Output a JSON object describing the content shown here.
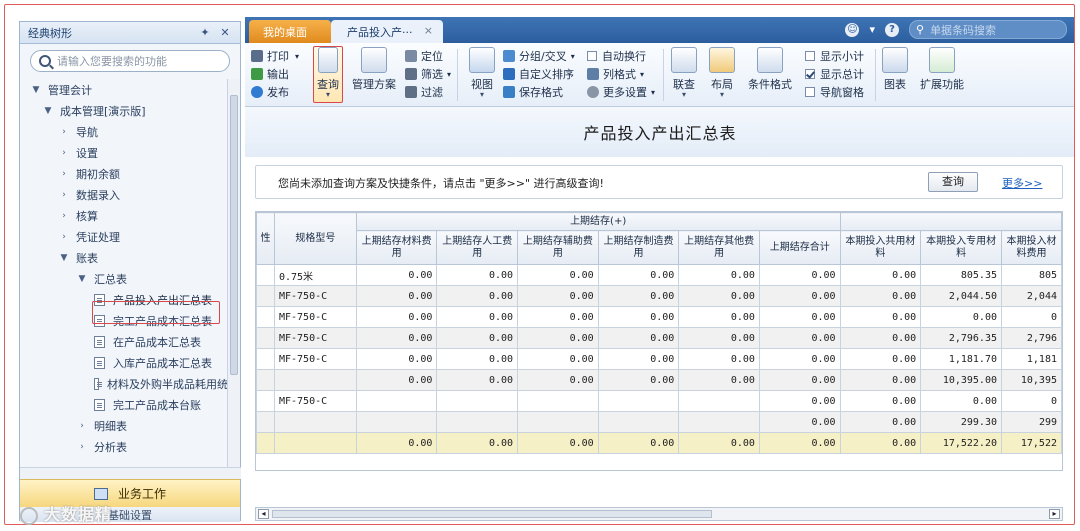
{
  "sidebar": {
    "title": "经典树形",
    "search_placeholder": "请输入您要搜索的功能",
    "tree": [
      {
        "label": "管理会计",
        "level": 0,
        "arrow": "▼"
      },
      {
        "label": "成本管理[演示版]",
        "level": 1,
        "arrow": "▼"
      },
      {
        "label": "导航",
        "level": 2,
        "arrow": "›"
      },
      {
        "label": "设置",
        "level": 2,
        "arrow": "›"
      },
      {
        "label": "期初余额",
        "level": 2,
        "arrow": "›"
      },
      {
        "label": "数据录入",
        "level": 2,
        "arrow": "›"
      },
      {
        "label": "核算",
        "level": 2,
        "arrow": "›"
      },
      {
        "label": "凭证处理",
        "level": 2,
        "arrow": "›"
      },
      {
        "label": "账表",
        "level": 2,
        "arrow": "▼"
      },
      {
        "label": "汇总表",
        "level": 3,
        "arrow": "▼"
      },
      {
        "label": "产品投入产出汇总表",
        "level": 4,
        "doc": true,
        "selected": true
      },
      {
        "label": "完工产品成本汇总表",
        "level": 4,
        "doc": true
      },
      {
        "label": "在产品成本汇总表",
        "level": 4,
        "doc": true
      },
      {
        "label": "入库产品成本汇总表",
        "level": 4,
        "doc": true
      },
      {
        "label": "材料及外购半成品耗用统",
        "level": 4,
        "doc": true
      },
      {
        "label": "完工产品成本台账",
        "level": 4,
        "doc": true
      },
      {
        "label": "明细表",
        "level": 3,
        "arrow": "›"
      },
      {
        "label": "分析表",
        "level": 3,
        "arrow": "›"
      }
    ],
    "work_label": "业务工作",
    "base_label": "基础设置"
  },
  "tabs": {
    "home": "我的桌面",
    "current": "产品投入产···",
    "search_placeholder": "单据条码搜索"
  },
  "toolbar": {
    "print": "打印",
    "export": "输出",
    "publish": "发布",
    "query": "查询",
    "plan": "管理方案",
    "locate": "定位",
    "filter": "筛选",
    "filter2": "过滤",
    "view": "视图",
    "group": "分组/交叉",
    "custom_sort": "自定义排序",
    "save_format": "保存格式",
    "auto_wrap": "自动换行",
    "col_format": "列格式",
    "more_settings": "更多设置",
    "link": "联查",
    "layout": "布局",
    "cond_format": "条件格式",
    "show_subtotal": "显示小计",
    "show_total": "显示总计",
    "nav_pane": "导航窗格",
    "chart": "图表",
    "extend": "扩展功能",
    "show_total_checked": true
  },
  "report": {
    "title": "产品投入产出汇总表",
    "hint": "您尚未添加查询方案及快捷条件，请点击 \"更多>>\" 进行高级查询!",
    "query_button": "查询",
    "more_link": "更多>>"
  },
  "table": {
    "group_header": "上期结存(+)",
    "col_first": "性",
    "col_spec": "规格型号",
    "columns": [
      "上期结存材料费用",
      "上期结存人工费用",
      "上期结存辅助费用",
      "上期结存制造费用",
      "上期结存其他费用",
      "上期结存合计",
      "本期投入共用材料",
      "本期投入专用材料",
      "本期投入材料费用"
    ],
    "rows": [
      {
        "spec": "0.75米",
        "vals": [
          "0.00",
          "0.00",
          "0.00",
          "0.00",
          "0.00",
          "0.00",
          "0.00",
          "805.35",
          "805"
        ]
      },
      {
        "spec": "MF-750-C",
        "vals": [
          "0.00",
          "0.00",
          "0.00",
          "0.00",
          "0.00",
          "0.00",
          "0.00",
          "2,044.50",
          "2,044"
        ]
      },
      {
        "spec": "MF-750-C",
        "vals": [
          "0.00",
          "0.00",
          "0.00",
          "0.00",
          "0.00",
          "0.00",
          "0.00",
          "0.00",
          "0"
        ]
      },
      {
        "spec": "MF-750-C",
        "vals": [
          "0.00",
          "0.00",
          "0.00",
          "0.00",
          "0.00",
          "0.00",
          "0.00",
          "2,796.35",
          "2,796"
        ]
      },
      {
        "spec": "MF-750-C",
        "vals": [
          "0.00",
          "0.00",
          "0.00",
          "0.00",
          "0.00",
          "0.00",
          "0.00",
          "1,181.70",
          "1,181"
        ]
      },
      {
        "spec": "",
        "vals": [
          "0.00",
          "0.00",
          "0.00",
          "0.00",
          "0.00",
          "0.00",
          "0.00",
          "10,395.00",
          "10,395"
        ]
      },
      {
        "spec": "MF-750-C",
        "vals": [
          "",
          "",
          "",
          "",
          "",
          "0.00",
          "0.00",
          "0.00",
          "0"
        ]
      },
      {
        "spec": "",
        "vals": [
          "",
          "",
          "",
          "",
          "",
          "0.00",
          "0.00",
          "299.30",
          "299"
        ]
      },
      {
        "spec": "",
        "vals": [
          "0.00",
          "0.00",
          "0.00",
          "0.00",
          "0.00",
          "0.00",
          "0.00",
          "17,522.20",
          "17,522"
        ],
        "total": true
      }
    ]
  },
  "watermark": "大数据精"
}
